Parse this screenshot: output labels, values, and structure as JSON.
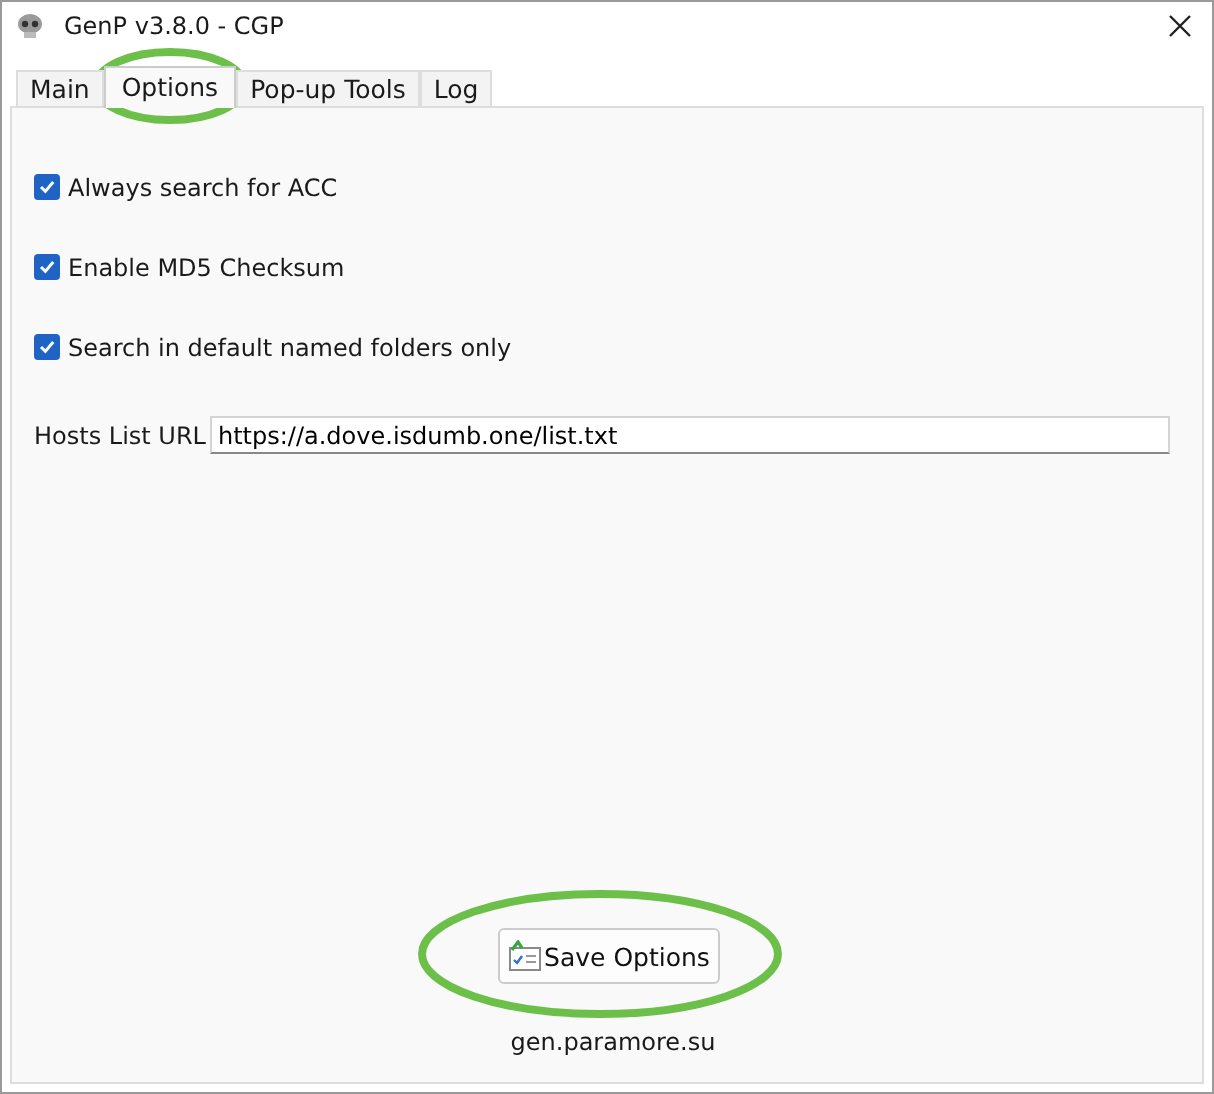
{
  "window": {
    "title": "GenP v3.8.0 - CGP"
  },
  "tabs": [
    {
      "label": "Main",
      "selected": false
    },
    {
      "label": "Options",
      "selected": true
    },
    {
      "label": "Pop-up Tools",
      "selected": false
    },
    {
      "label": "Log",
      "selected": false
    }
  ],
  "options": [
    {
      "label": "Always search for ACC",
      "checked": true
    },
    {
      "label": "Enable MD5 Checksum",
      "checked": true
    },
    {
      "label": "Search in default named folders only",
      "checked": true
    }
  ],
  "hosts_list": {
    "label": "Hosts List URL",
    "value": "https://a.dove.isdumb.one/list.txt"
  },
  "save_button": {
    "label": "Save Options"
  },
  "footer": "gen.paramore.su"
}
